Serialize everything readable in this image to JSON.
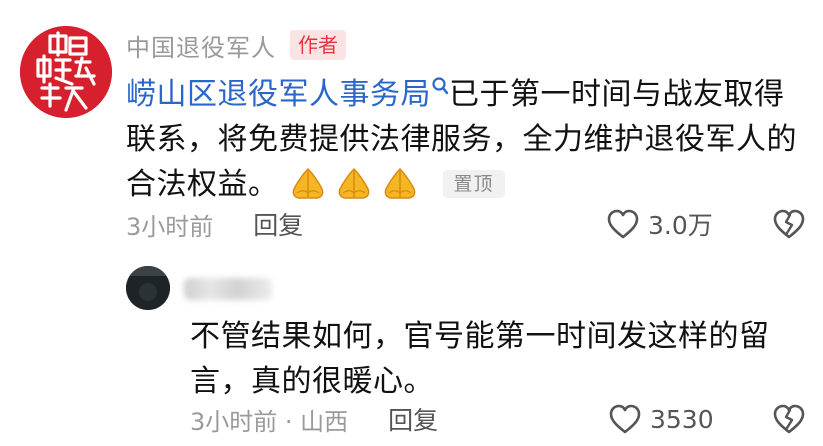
{
  "main_comment": {
    "author": "中国退役军人",
    "author_badge": "作者",
    "mention": "崂山区退役军人事务局",
    "text_after_mention": "已于第一时间与战友取得联系，将免费提供法律服务，全力维护退役军人的合法权益。",
    "emoji_icon": "folded-hands",
    "emoji_count": 3,
    "pin_label": "置顶",
    "time": "3小时前",
    "reply_label": "回复",
    "like_count": "3.0万"
  },
  "reply_comment": {
    "text": "不管结果如何，官号能第一时间发这样的留言，真的很暖心。",
    "time_location": "3小时前 · 山西",
    "reply_label": "回复",
    "like_count": "3530"
  },
  "colors": {
    "mention_link": "#2a67c9",
    "badge_red": "#e8343f",
    "avatar_red": "#d7202d"
  },
  "avatar_logo_text": "中国退役军人"
}
